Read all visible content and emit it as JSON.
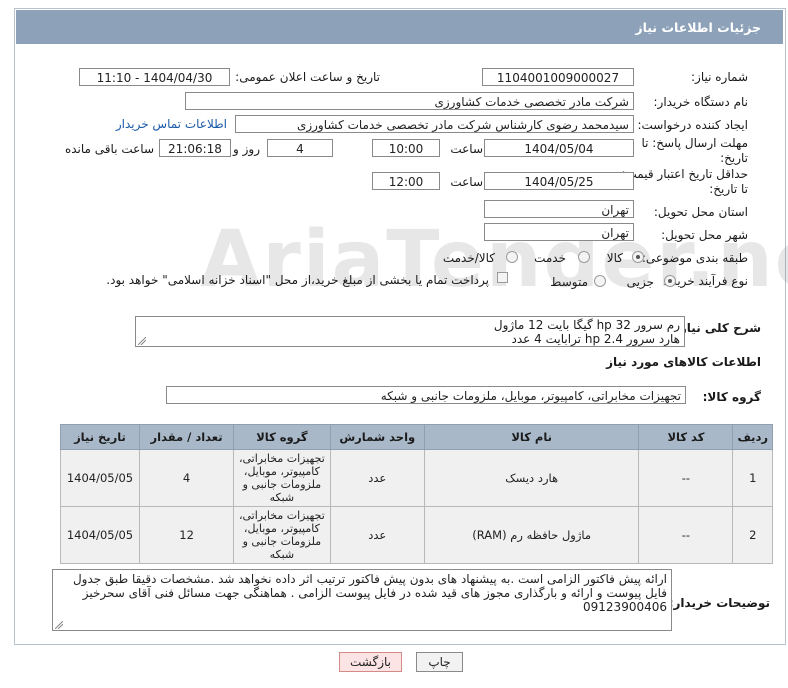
{
  "header": {
    "title": "جزئیات اطلاعات نیاز"
  },
  "need_number": {
    "label": "شماره نیاز:",
    "value": "1104001009000027"
  },
  "announce_datetime": {
    "label": "تاریخ و ساعت اعلان عمومی:",
    "value": "1404/04/30 - 11:10"
  },
  "buyer_org": {
    "label": "نام دستگاه خریدار:",
    "value": "شرکت مادر تخصصی خدمات کشاورزی"
  },
  "requester": {
    "label": "ایجاد کننده درخواست:",
    "value": "سیدمحمد رضوی کارشناس شرکت مادر تخصصی خدمات کشاورزی",
    "contact_link": "اطلاعات تماس خریدار"
  },
  "reply_deadline": {
    "label_line1": "مهلت ارسال پاسخ: تا",
    "label_line2": "تاریخ:",
    "date": "1404/05/04",
    "time_label": "ساعت",
    "time": "10:00",
    "days": "4",
    "days_label": "روز و",
    "remaining": "21:06:18",
    "remaining_label": "ساعت باقی مانده"
  },
  "min_price_validity": {
    "label_line1": "حداقل تاریخ اعتبار قیمت:",
    "label_line2": "تا تاریخ:",
    "date": "1404/05/25",
    "time_label": "ساعت",
    "time": "12:00"
  },
  "province": {
    "label": "استان محل تحویل:",
    "value": "تهران"
  },
  "city": {
    "label": "شهر محل تحویل:",
    "value": "تهران"
  },
  "category": {
    "label": "طبقه بندی موضوعی:",
    "options": [
      "کالا",
      "خدمت",
      "کالا/خدمت"
    ],
    "selected": "کالا"
  },
  "process_type": {
    "label": "نوع فرآیند خرید :",
    "options": [
      "جزیی",
      "متوسط"
    ],
    "payment_note": "پرداخت تمام یا بخشی از مبلغ خرید،از محل \"اسناد خزانه اسلامی\" خواهد بود."
  },
  "watermark": "AriaTender.neT",
  "description": {
    "label": "شرح کلی نیاز:",
    "lines": [
      "رم سرور hp 32 گیگا بایت 12 ماژول",
      "هارد سرور hp 2.4 ترابایت 4 عدد"
    ]
  },
  "goods_info_title": "اطلاعات کالاهای مورد نیاز",
  "goods_group": {
    "label": "گروه کالا:",
    "value": "تجهیزات مخابراتی، کامپیوتر، موبایل، ملزومات جانبی و شبکه"
  },
  "table": {
    "headers": [
      "ردیف",
      "کد کالا",
      "نام کالا",
      "واحد شمارش",
      "گروه کالا",
      "تعداد / مقدار",
      "تاریخ نیاز"
    ],
    "rows": [
      [
        "1",
        "--",
        "هارد دیسک",
        "عدد",
        "تجهیزات مخابراتی، کامپیوتر، موبایل، ملزومات جانبی و شبکه",
        "4",
        "1404/05/05"
      ],
      [
        "2",
        "--",
        "ماژول حافظه رم (RAM)",
        "عدد",
        "تجهیزات مخابراتی، کامپیوتر، موبایل، ملزومات جانبی و شبکه",
        "12",
        "1404/05/05"
      ]
    ]
  },
  "buyer_notes": {
    "label": "توضیحات خریدار:",
    "text": "ارائه پیش فاکتور الزامی است .به پیشنهاد های بدون پیش فاکتور ترتیب اثر داده نخواهد شد .مشخصات دقیقا طبق جدول فایل پیوست و ارائه و بارگذاری مجوز های قید شده در فایل پیوست الزامی . هماهنگی جهت مسائل فنی آقای سحرخیز 09123900406"
  },
  "buttons": {
    "print": "چاپ",
    "back": "بازگشت"
  }
}
